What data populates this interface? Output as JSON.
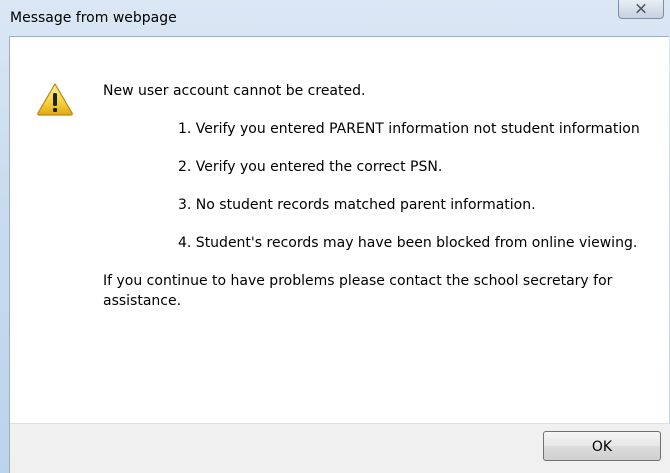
{
  "dialog": {
    "title": "Message from webpage",
    "close_glyph": "✕"
  },
  "message": {
    "intro": "New user account cannot be created.",
    "items": [
      "1. Verify you entered PARENT information not student information",
      "2. Verify you entered the correct PSN.",
      "3. No student records matched parent information.",
      "4. Student's records may have been blocked from online viewing."
    ],
    "closing": "If you continue to have problems please contact the school secretary for assistance."
  },
  "buttons": {
    "ok_label": "OK"
  },
  "icons": {
    "status": "warning-icon",
    "close": "close-icon"
  },
  "colors": {
    "titlebar": "#c9dcf0",
    "footer": "#f0f0f0",
    "warning_fill": "#f4d03f"
  }
}
